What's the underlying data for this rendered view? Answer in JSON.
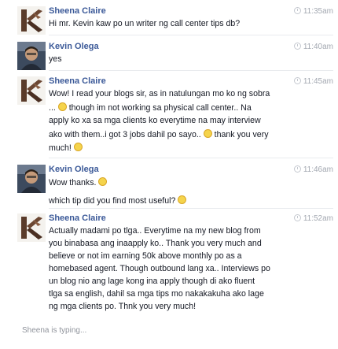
{
  "thread": {
    "messages": [
      {
        "sender": "Sheena Claire",
        "time": "11:35am",
        "lines": [
          "Hi mr. Kevin kaw po un writer ng call center tips db?"
        ]
      },
      {
        "sender": "Kevin Olega",
        "time": "11:40am",
        "lines": [
          "yes"
        ]
      },
      {
        "sender": "Sheena Claire",
        "time": "11:45am",
        "lines": [
          "Wow! I read your blogs sir, as in natulungan mo ko ng sobra",
          "... ",
          " though im not working sa physical call center.. Na",
          "apply ko xa sa mga clients ko everytime na may interview",
          "ako with them..i got 3 jobs dahil po sayo.. ",
          " thank you very",
          "much! "
        ]
      },
      {
        "sender": "Kevin Olega",
        "time": "11:46am",
        "lines": [
          "Wow thanks. ",
          "which tip did you find most useful? "
        ]
      },
      {
        "sender": "Sheena Claire",
        "time": "11:52am",
        "lines": [
          "Actually madami po tlga.. Everytime na my new blog from",
          "you binabasa ang inaapply ko..  Thank you very much and",
          "believe or not im earning 50k above monthly po as a",
          "homebased agent. Though outbound lang xa.. Interviews po",
          "un blog nio ang lage kong ina apply   though di ako fluent",
          "tlga sa english, dahil sa mga tips mo nakakakuha ako lage",
          "ng mga clients po. Thnk you very much!"
        ]
      }
    ],
    "typing_status": "Sheena is typing..."
  }
}
